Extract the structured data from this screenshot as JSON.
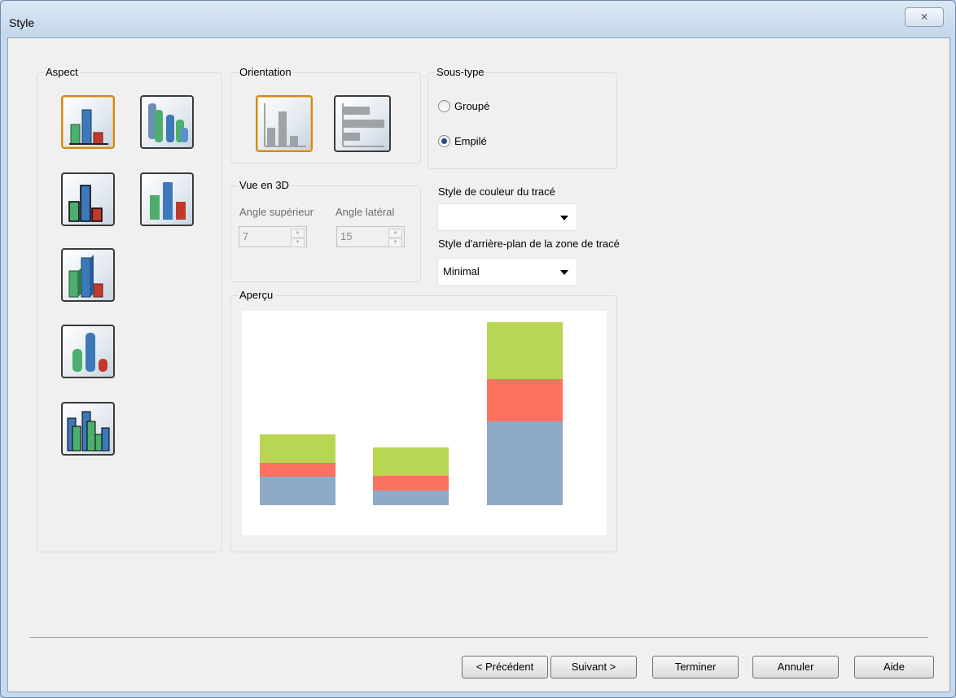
{
  "window": {
    "title": "Style",
    "close_glyph": "⨯"
  },
  "groups": {
    "aspect": "Aspect",
    "orientation": "Orientation",
    "subtype": "Sous-type",
    "view3d": "Vue en 3D",
    "preview": "Aperçu"
  },
  "aspect_icons": [
    {
      "name": "flat-bar-style-icon",
      "selected": true
    },
    {
      "name": "cylinder-bar-style-icon",
      "selected": false
    },
    {
      "name": "outlined-bar-style-icon",
      "selected": false
    },
    {
      "name": "shaded-bar-style-icon",
      "selected": false
    },
    {
      "name": "3d-bar-style-icon",
      "selected": false
    },
    {
      "name": "cylinder-shaded-bar-style-icon",
      "selected": false
    },
    {
      "name": "clustered-3d-bar-style-icon",
      "selected": false
    }
  ],
  "orientation_icons": [
    {
      "name": "vertical-bars-icon",
      "selected": true
    },
    {
      "name": "horizontal-bars-icon",
      "selected": false
    }
  ],
  "subtype": {
    "options": [
      "Groupé",
      "Empilé"
    ],
    "selected": "Empilé"
  },
  "view3d": {
    "top_angle_label": "Angle supérieur",
    "top_angle_value": "7",
    "side_angle_label": "Angle latéral",
    "side_angle_value": "15"
  },
  "plot_color_style": {
    "label": "Style de couleur du tracé",
    "value": ""
  },
  "plot_bg_style": {
    "label": "Style d'arrière-plan de la zone de tracé",
    "value": "Minimal"
  },
  "colors": {
    "blue": "#8eaac8",
    "red": "#fc7260",
    "green": "#b9d554"
  },
  "chart_data": {
    "type": "bar",
    "stacked": true,
    "categories": [
      "",
      "",
      ""
    ],
    "series": [
      {
        "values": [
          35,
          18,
          103
        ],
        "color": "#8eaac8"
      },
      {
        "values": [
          17,
          18,
          52
        ],
        "color": "#fc7260"
      },
      {
        "values": [
          35,
          35,
          70
        ],
        "color": "#b9d554"
      }
    ],
    "ylim": [
      0,
      240
    ],
    "grid": false,
    "legend": "none"
  },
  "buttons": {
    "previous": "< Précédent",
    "next": "Suivant >",
    "finish": "Terminer",
    "cancel": "Annuler",
    "help": "Aide"
  }
}
